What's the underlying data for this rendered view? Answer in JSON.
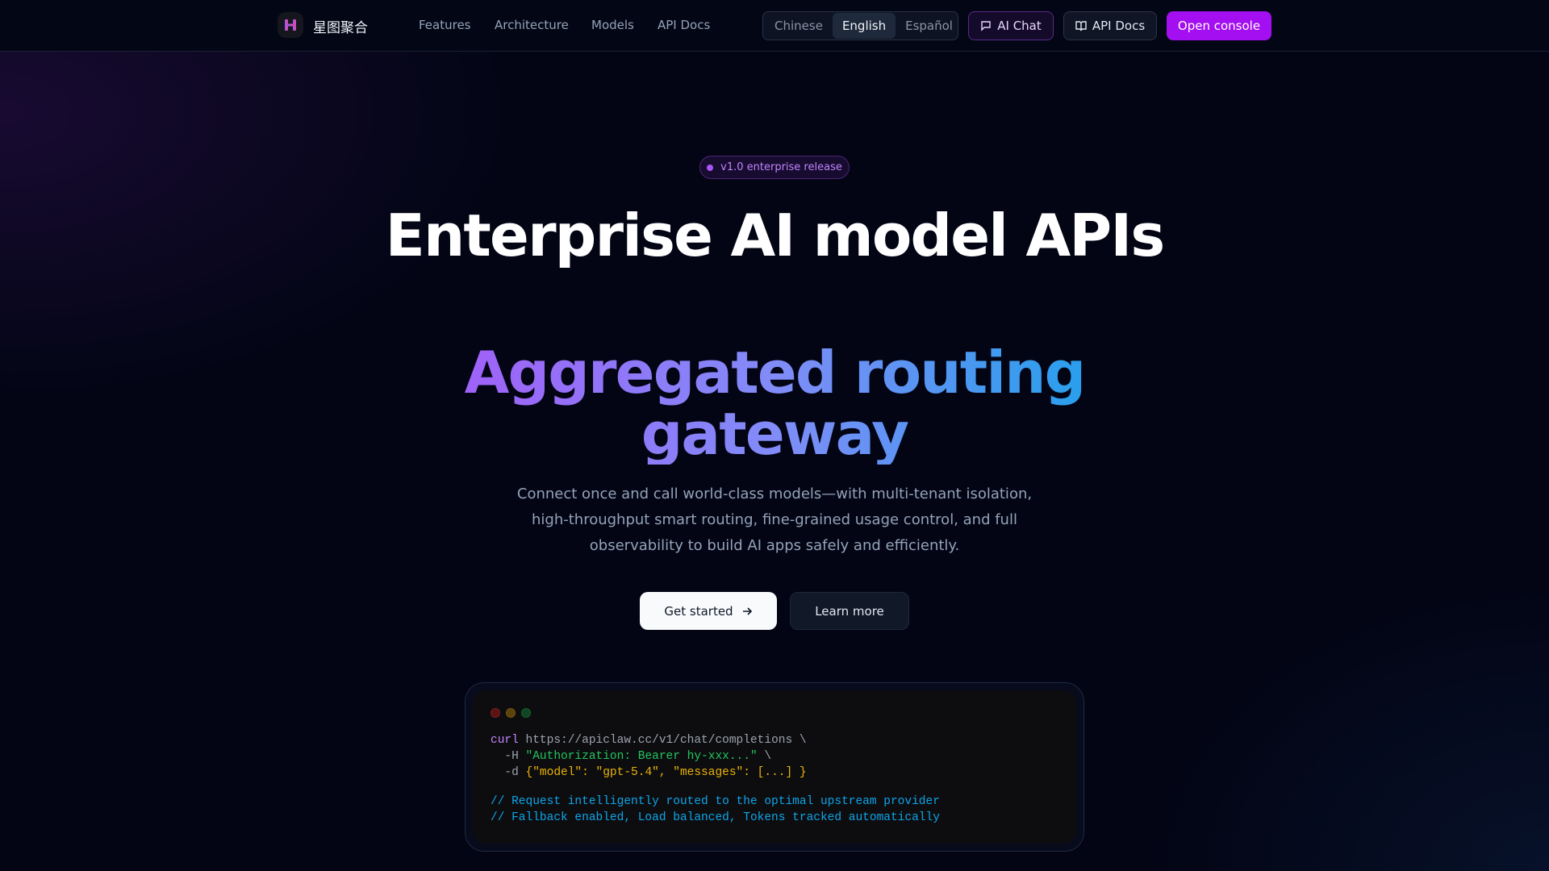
{
  "nav": {
    "brand": "星图聚合",
    "links": [
      "Features",
      "Architecture",
      "Models",
      "API Docs"
    ],
    "languages": [
      "Chinese",
      "English",
      "Español"
    ],
    "active_language": "English",
    "ai_chat": "AI Chat",
    "api_docs": "API Docs",
    "open_console": "Open console"
  },
  "hero": {
    "badge": "v1.0 enterprise release",
    "title": "Enterprise AI model APIs",
    "title_gradient": "Aggregated routing gateway",
    "subtitle": "Connect once and call world-class models—with multi-tenant isolation, high-throughput smart routing, fine-grained usage control, and full observability to build AI apps safely and efficiently.",
    "get_started": "Get started",
    "learn_more": "Learn more"
  },
  "code": {
    "cmd": "curl",
    "url": " https://apiclaw.cc/v1/chat/completions \\",
    "h_flag": "  -H ",
    "h_val": "\"Authorization: Bearer hy-xxx...\"",
    "h_end": " \\",
    "d_flag": "  -d ",
    "d_val": "{\"model\": \"gpt-5.4\", \"messages\": [...] }",
    "comment1": "// Request intelligently routed to the optimal upstream provider",
    "comment2": "// Fallback enabled, Load balanced, Tokens tracked automatically"
  },
  "colors": {
    "accent": "#a30ff0",
    "purple": "#a855f7",
    "blue": "#0ea5e9"
  }
}
